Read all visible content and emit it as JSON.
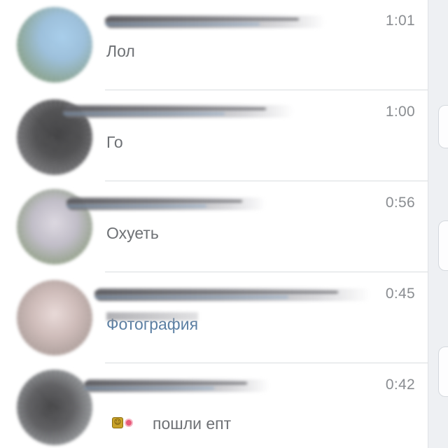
{
  "conversations": [
    {
      "time": "1:01",
      "last_message": "Лол",
      "message_type": "text",
      "avatar_color": "#8fb7d6"
    },
    {
      "time": "1:00",
      "last_message": "Го",
      "message_type": "text",
      "avatar_color": "#3a3a3c"
    },
    {
      "time": "0:56",
      "last_message": "Охуеть",
      "message_type": "text",
      "avatar_color": "#b8b4c0"
    },
    {
      "time": "0:45",
      "last_message": "Фотография",
      "message_type": "attachment",
      "avatar_color": "#c8b3b0"
    },
    {
      "time": "0:42",
      "last_message": "пошли епт",
      "message_type": "text_with_emoji",
      "emojis": [
        "old-man-emoji",
        "flower-emoji"
      ],
      "avatar_color": "#4a4a4d"
    }
  ],
  "colors": {
    "time_text": "#8a8d91",
    "message_text": "#6e7175",
    "link_text": "#5b7fa3",
    "divider": "#d9dcdf",
    "background": "#ffffff"
  }
}
